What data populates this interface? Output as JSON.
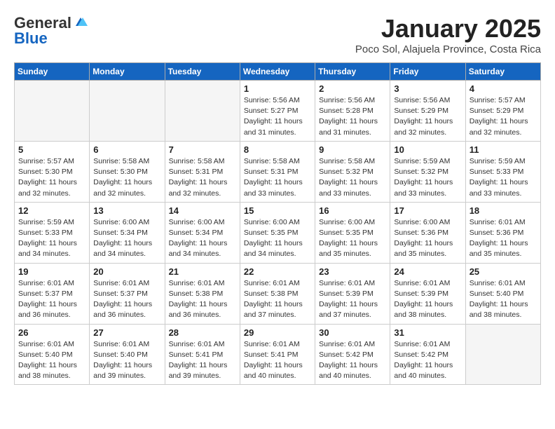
{
  "header": {
    "logo_general": "General",
    "logo_blue": "Blue",
    "title": "January 2025",
    "subtitle": "Poco Sol, Alajuela Province, Costa Rica"
  },
  "weekdays": [
    "Sunday",
    "Monday",
    "Tuesday",
    "Wednesday",
    "Thursday",
    "Friday",
    "Saturday"
  ],
  "weeks": [
    [
      {
        "day": "",
        "info": ""
      },
      {
        "day": "",
        "info": ""
      },
      {
        "day": "",
        "info": ""
      },
      {
        "day": "1",
        "info": "Sunrise: 5:56 AM\nSunset: 5:27 PM\nDaylight: 11 hours\nand 31 minutes."
      },
      {
        "day": "2",
        "info": "Sunrise: 5:56 AM\nSunset: 5:28 PM\nDaylight: 11 hours\nand 31 minutes."
      },
      {
        "day": "3",
        "info": "Sunrise: 5:56 AM\nSunset: 5:29 PM\nDaylight: 11 hours\nand 32 minutes."
      },
      {
        "day": "4",
        "info": "Sunrise: 5:57 AM\nSunset: 5:29 PM\nDaylight: 11 hours\nand 32 minutes."
      }
    ],
    [
      {
        "day": "5",
        "info": "Sunrise: 5:57 AM\nSunset: 5:30 PM\nDaylight: 11 hours\nand 32 minutes."
      },
      {
        "day": "6",
        "info": "Sunrise: 5:58 AM\nSunset: 5:30 PM\nDaylight: 11 hours\nand 32 minutes."
      },
      {
        "day": "7",
        "info": "Sunrise: 5:58 AM\nSunset: 5:31 PM\nDaylight: 11 hours\nand 32 minutes."
      },
      {
        "day": "8",
        "info": "Sunrise: 5:58 AM\nSunset: 5:31 PM\nDaylight: 11 hours\nand 33 minutes."
      },
      {
        "day": "9",
        "info": "Sunrise: 5:58 AM\nSunset: 5:32 PM\nDaylight: 11 hours\nand 33 minutes."
      },
      {
        "day": "10",
        "info": "Sunrise: 5:59 AM\nSunset: 5:32 PM\nDaylight: 11 hours\nand 33 minutes."
      },
      {
        "day": "11",
        "info": "Sunrise: 5:59 AM\nSunset: 5:33 PM\nDaylight: 11 hours\nand 33 minutes."
      }
    ],
    [
      {
        "day": "12",
        "info": "Sunrise: 5:59 AM\nSunset: 5:33 PM\nDaylight: 11 hours\nand 34 minutes."
      },
      {
        "day": "13",
        "info": "Sunrise: 6:00 AM\nSunset: 5:34 PM\nDaylight: 11 hours\nand 34 minutes."
      },
      {
        "day": "14",
        "info": "Sunrise: 6:00 AM\nSunset: 5:34 PM\nDaylight: 11 hours\nand 34 minutes."
      },
      {
        "day": "15",
        "info": "Sunrise: 6:00 AM\nSunset: 5:35 PM\nDaylight: 11 hours\nand 34 minutes."
      },
      {
        "day": "16",
        "info": "Sunrise: 6:00 AM\nSunset: 5:35 PM\nDaylight: 11 hours\nand 35 minutes."
      },
      {
        "day": "17",
        "info": "Sunrise: 6:00 AM\nSunset: 5:36 PM\nDaylight: 11 hours\nand 35 minutes."
      },
      {
        "day": "18",
        "info": "Sunrise: 6:01 AM\nSunset: 5:36 PM\nDaylight: 11 hours\nand 35 minutes."
      }
    ],
    [
      {
        "day": "19",
        "info": "Sunrise: 6:01 AM\nSunset: 5:37 PM\nDaylight: 11 hours\nand 36 minutes."
      },
      {
        "day": "20",
        "info": "Sunrise: 6:01 AM\nSunset: 5:37 PM\nDaylight: 11 hours\nand 36 minutes."
      },
      {
        "day": "21",
        "info": "Sunrise: 6:01 AM\nSunset: 5:38 PM\nDaylight: 11 hours\nand 36 minutes."
      },
      {
        "day": "22",
        "info": "Sunrise: 6:01 AM\nSunset: 5:38 PM\nDaylight: 11 hours\nand 37 minutes."
      },
      {
        "day": "23",
        "info": "Sunrise: 6:01 AM\nSunset: 5:39 PM\nDaylight: 11 hours\nand 37 minutes."
      },
      {
        "day": "24",
        "info": "Sunrise: 6:01 AM\nSunset: 5:39 PM\nDaylight: 11 hours\nand 38 minutes."
      },
      {
        "day": "25",
        "info": "Sunrise: 6:01 AM\nSunset: 5:40 PM\nDaylight: 11 hours\nand 38 minutes."
      }
    ],
    [
      {
        "day": "26",
        "info": "Sunrise: 6:01 AM\nSunset: 5:40 PM\nDaylight: 11 hours\nand 38 minutes."
      },
      {
        "day": "27",
        "info": "Sunrise: 6:01 AM\nSunset: 5:40 PM\nDaylight: 11 hours\nand 39 minutes."
      },
      {
        "day": "28",
        "info": "Sunrise: 6:01 AM\nSunset: 5:41 PM\nDaylight: 11 hours\nand 39 minutes."
      },
      {
        "day": "29",
        "info": "Sunrise: 6:01 AM\nSunset: 5:41 PM\nDaylight: 11 hours\nand 40 minutes."
      },
      {
        "day": "30",
        "info": "Sunrise: 6:01 AM\nSunset: 5:42 PM\nDaylight: 11 hours\nand 40 minutes."
      },
      {
        "day": "31",
        "info": "Sunrise: 6:01 AM\nSunset: 5:42 PM\nDaylight: 11 hours\nand 40 minutes."
      },
      {
        "day": "",
        "info": ""
      }
    ]
  ]
}
